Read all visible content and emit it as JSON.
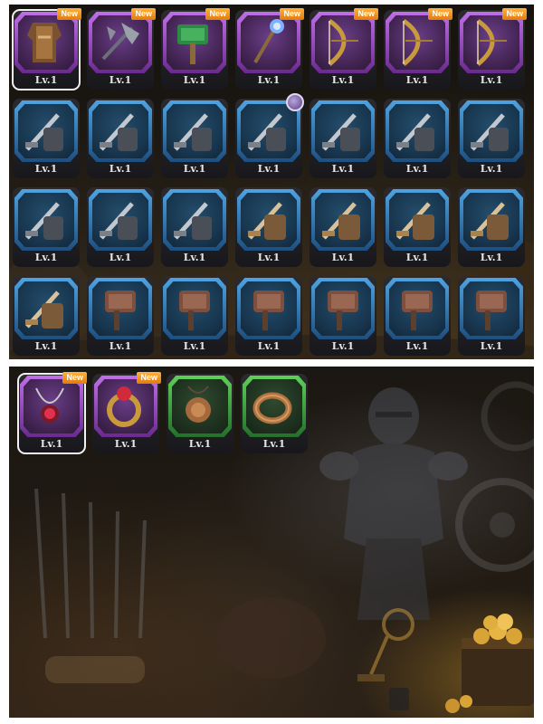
{
  "top_inventory": {
    "rows": [
      [
        {
          "icon": "leather-armor-icon",
          "rarity": "purple",
          "level": "Lv.1",
          "badge": "New",
          "selected": true
        },
        {
          "icon": "spiked-axe-icon",
          "rarity": "purple",
          "level": "Lv.1",
          "badge": "New"
        },
        {
          "icon": "green-hammer-icon",
          "rarity": "purple",
          "level": "Lv.1",
          "badge": "New"
        },
        {
          "icon": "crystal-staff-icon",
          "rarity": "purple",
          "level": "Lv.1",
          "badge": "New"
        },
        {
          "icon": "golden-bow-icon",
          "rarity": "purple",
          "level": "Lv.1",
          "badge": "New"
        },
        {
          "icon": "golden-bow-icon",
          "rarity": "purple",
          "level": "Lv.1",
          "badge": "New"
        },
        {
          "icon": "golden-bow-icon",
          "rarity": "purple",
          "level": "Lv.1",
          "badge": "New"
        }
      ],
      [
        {
          "icon": "sword-gauntlet-icon",
          "rarity": "blue",
          "level": "Lv.1"
        },
        {
          "icon": "sword-gauntlet-icon",
          "rarity": "blue",
          "level": "Lv.1"
        },
        {
          "icon": "sword-gauntlet-icon",
          "rarity": "blue",
          "level": "Lv.1"
        },
        {
          "icon": "sword-gauntlet-icon",
          "rarity": "blue",
          "level": "Lv.1",
          "equipped_avatar": true
        },
        {
          "icon": "sword-gauntlet-icon",
          "rarity": "blue",
          "level": "Lv.1"
        },
        {
          "icon": "sword-gauntlet-icon",
          "rarity": "blue",
          "level": "Lv.1"
        },
        {
          "icon": "sword-gauntlet-icon",
          "rarity": "blue",
          "level": "Lv.1"
        }
      ],
      [
        {
          "icon": "sword-gauntlet-icon",
          "rarity": "blue",
          "level": "Lv.1"
        },
        {
          "icon": "sword-gauntlet-icon",
          "rarity": "blue",
          "level": "Lv.1"
        },
        {
          "icon": "sword-gauntlet-icon",
          "rarity": "blue",
          "level": "Lv.1"
        },
        {
          "icon": "bronze-sword-icon",
          "rarity": "blue",
          "level": "Lv.1"
        },
        {
          "icon": "bronze-sword-icon",
          "rarity": "blue",
          "level": "Lv.1"
        },
        {
          "icon": "bronze-sword-icon",
          "rarity": "blue",
          "level": "Lv.1"
        },
        {
          "icon": "bronze-sword-icon",
          "rarity": "blue",
          "level": "Lv.1"
        }
      ],
      [
        {
          "icon": "bronze-sword-icon",
          "rarity": "blue",
          "level": "Lv.1"
        },
        {
          "icon": "war-hammer-icon",
          "rarity": "blue",
          "level": "Lv.1"
        },
        {
          "icon": "war-hammer-icon",
          "rarity": "blue",
          "level": "Lv.1"
        },
        {
          "icon": "war-hammer-icon",
          "rarity": "blue",
          "level": "Lv.1"
        },
        {
          "icon": "war-hammer-icon",
          "rarity": "blue",
          "level": "Lv.1"
        },
        {
          "icon": "war-hammer-icon",
          "rarity": "blue",
          "level": "Lv.1"
        },
        {
          "icon": "war-hammer-icon",
          "rarity": "blue",
          "level": "Lv.1"
        }
      ]
    ]
  },
  "bottom_inventory": {
    "items": [
      {
        "icon": "ruby-necklace-icon",
        "rarity": "purple",
        "level": "Lv.1",
        "badge": "New",
        "selected": true
      },
      {
        "icon": "ruby-ring-icon",
        "rarity": "purple",
        "level": "Lv.1",
        "badge": "New"
      },
      {
        "icon": "bronze-amulet-icon",
        "rarity": "green",
        "level": "Lv.1"
      },
      {
        "icon": "bronze-ring-icon",
        "rarity": "green",
        "level": "Lv.1"
      }
    ]
  },
  "colors": {
    "purple_frame": "#a855d6",
    "blue_frame": "#3b8ad0",
    "green_frame": "#3fae3f",
    "badge": "#f39a1e",
    "level_text": "#e6e6e6"
  }
}
